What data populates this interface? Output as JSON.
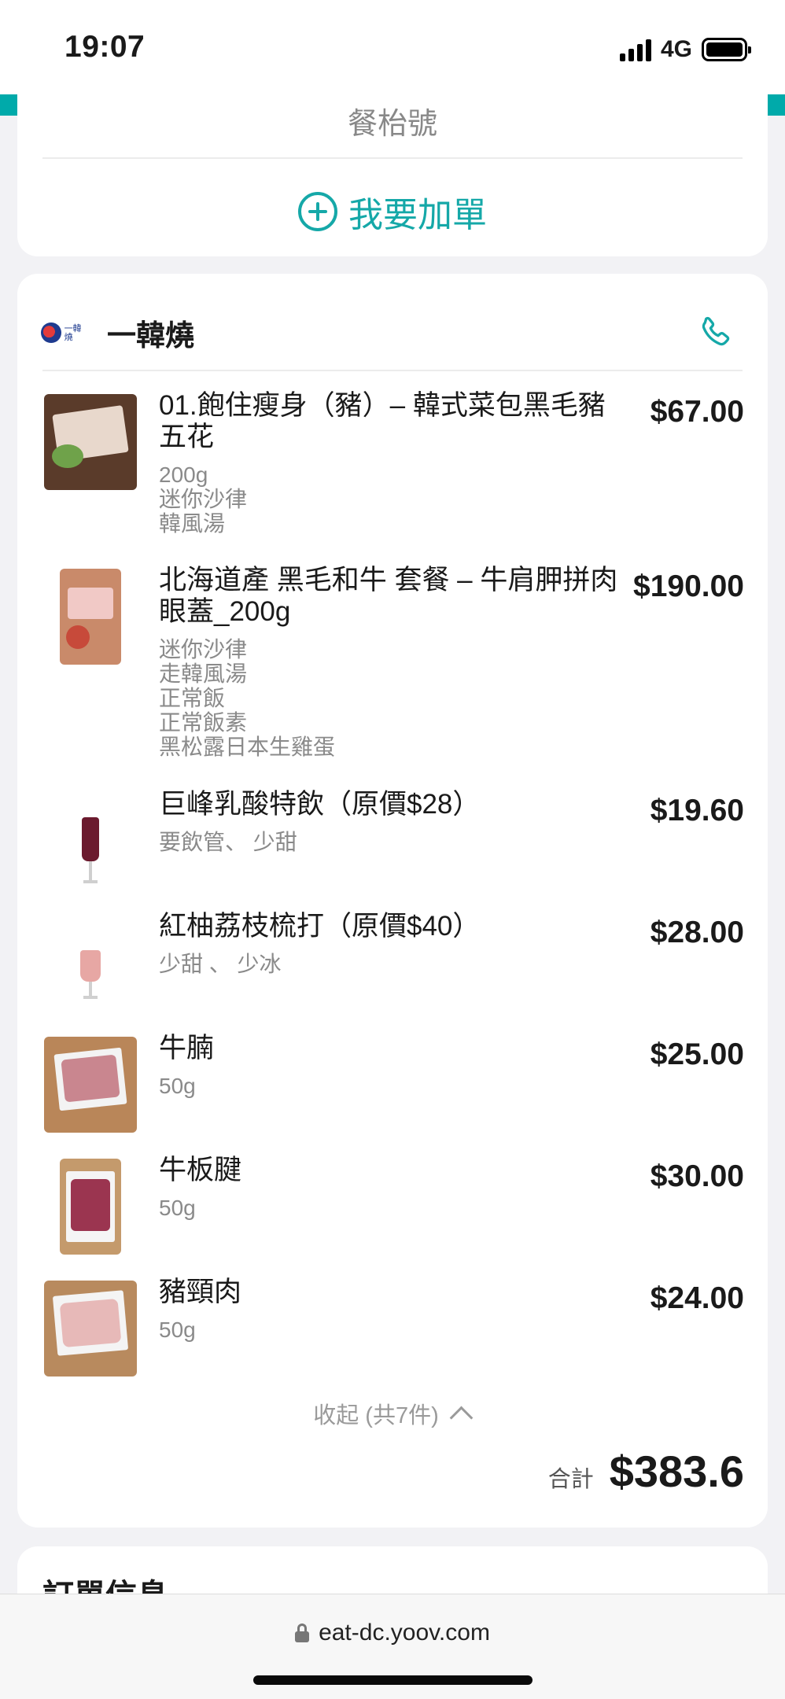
{
  "status_bar": {
    "time": "19:07",
    "network": "4G"
  },
  "table_card": {
    "table_label": "餐枱號",
    "add_order_label": "我要加單"
  },
  "order": {
    "restaurant_name": "一韓燒",
    "logo_text": "一韓燒",
    "items": [
      {
        "name": "01.飽住瘦身（豬）– 韓式菜包黑毛豬五花",
        "options": [
          "200g",
          "迷你沙律",
          "韓風湯"
        ],
        "price": "$67.00",
        "thumb_color": "#5a3b2a"
      },
      {
        "name": "北海道產 黑毛和牛 套餐 – 牛肩胛拼肉眼蓋_200g",
        "options": [
          "迷你沙律",
          "走韓風湯",
          "正常飯",
          "正常飯素",
          "黑松露日本生雞蛋"
        ],
        "price": "$190.00",
        "thumb_color": "#c98a6a"
      },
      {
        "name": "巨峰乳酸特飲（原價$28）",
        "options": [
          "要飲管、 少甜"
        ],
        "price": "$19.60",
        "thumb_color": "#6b1a2e"
      },
      {
        "name": "紅柚荔枝梳打（原價$40）",
        "options": [
          "少甜 、 少冰"
        ],
        "price": "$28.00",
        "thumb_color": "#e7a7a4"
      },
      {
        "name": "牛腩",
        "options": [
          "50g"
        ],
        "price": "$25.00",
        "thumb_color": "#c9868f"
      },
      {
        "name": "牛板腱",
        "options": [
          "50g"
        ],
        "price": "$30.00",
        "thumb_color": "#9b3550"
      },
      {
        "name": "豬頸肉",
        "options": [
          "50g"
        ],
        "price": "$24.00",
        "thumb_color": "#e7b9b8"
      }
    ],
    "collapse_label": "收起 (共7件)",
    "total_label": "合計",
    "total_value": "$383.6"
  },
  "info_card": {
    "title": "訂單信息"
  },
  "browser": {
    "url": "eat-dc.yoov.com"
  },
  "colors": {
    "accent": "#15a8a8",
    "teal_strip": "#00aaaa"
  }
}
